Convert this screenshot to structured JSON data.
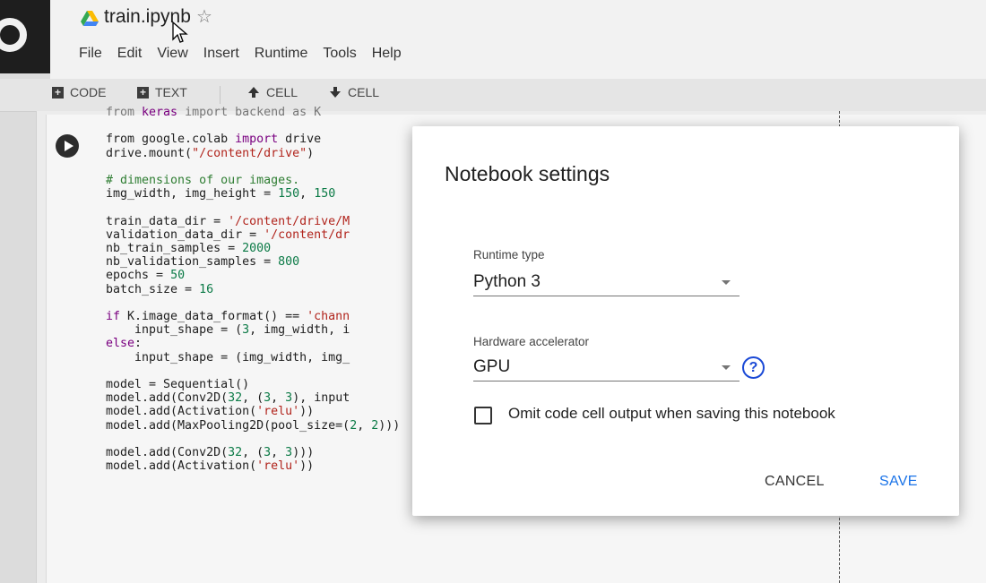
{
  "header": {
    "title": "train.ipynb",
    "star_icon": "☆",
    "menu": [
      {
        "label": "File"
      },
      {
        "label": "Edit"
      },
      {
        "label": "View"
      },
      {
        "label": "Insert"
      },
      {
        "label": "Runtime"
      },
      {
        "label": "Tools"
      },
      {
        "label": "Help"
      }
    ]
  },
  "toolbar": {
    "code_label": "CODE",
    "text_label": "TEXT",
    "cell_up_label": "CELL",
    "cell_down_label": "CELL"
  },
  "code_lines": [
    [
      [
        "t",
        "from "
      ],
      [
        "k",
        "keras"
      ],
      [
        "t",
        " import backend as K"
      ]
    ],
    [
      [
        "t",
        ""
      ]
    ],
    [
      [
        "t",
        "from google.colab "
      ],
      [
        "k",
        "import"
      ],
      [
        "t",
        " drive"
      ]
    ],
    [
      [
        "t",
        "drive.mount("
      ],
      [
        "s",
        "\"/content/drive\""
      ],
      [
        "t",
        ")"
      ]
    ],
    [
      [
        "t",
        ""
      ]
    ],
    [
      [
        "c",
        "# dimensions of our images."
      ]
    ],
    [
      [
        "t",
        "img_width, img_height = "
      ],
      [
        "n",
        "150"
      ],
      [
        "t",
        ", "
      ],
      [
        "n",
        "150"
      ]
    ],
    [
      [
        "t",
        ""
      ]
    ],
    [
      [
        "t",
        "train_data_dir = "
      ],
      [
        "s",
        "'/content/drive/M"
      ]
    ],
    [
      [
        "t",
        "validation_data_dir = "
      ],
      [
        "s",
        "'/content/dr"
      ]
    ],
    [
      [
        "t",
        "nb_train_samples = "
      ],
      [
        "n",
        "2000"
      ]
    ],
    [
      [
        "t",
        "nb_validation_samples = "
      ],
      [
        "n",
        "800"
      ]
    ],
    [
      [
        "t",
        "epochs = "
      ],
      [
        "n",
        "50"
      ]
    ],
    [
      [
        "t",
        "batch_size = "
      ],
      [
        "n",
        "16"
      ]
    ],
    [
      [
        "t",
        ""
      ]
    ],
    [
      [
        "k",
        "if"
      ],
      [
        "t",
        " K.image_data_format() == "
      ],
      [
        "s",
        "'chann"
      ]
    ],
    [
      [
        "t",
        "    input_shape = ("
      ],
      [
        "n",
        "3"
      ],
      [
        "t",
        ", img_width, i"
      ]
    ],
    [
      [
        "k",
        "else"
      ],
      [
        "t",
        ":"
      ]
    ],
    [
      [
        "t",
        "    input_shape = (img_width, img_"
      ]
    ],
    [
      [
        "t",
        ""
      ]
    ],
    [
      [
        "t",
        "model = Sequential()"
      ]
    ],
    [
      [
        "t",
        "model.add(Conv2D("
      ],
      [
        "n",
        "32"
      ],
      [
        "t",
        ", ("
      ],
      [
        "n",
        "3"
      ],
      [
        "t",
        ", "
      ],
      [
        "n",
        "3"
      ],
      [
        "t",
        "), input"
      ]
    ],
    [
      [
        "t",
        "model.add(Activation("
      ],
      [
        "s",
        "'relu'"
      ],
      [
        "t",
        "))"
      ]
    ],
    [
      [
        "t",
        "model.add(MaxPooling2D(pool_size=("
      ],
      [
        "n",
        "2"
      ],
      [
        "t",
        ", "
      ],
      [
        "n",
        "2"
      ],
      [
        "t",
        ")))"
      ]
    ],
    [
      [
        "t",
        ""
      ]
    ],
    [
      [
        "t",
        "model.add(Conv2D("
      ],
      [
        "n",
        "32"
      ],
      [
        "t",
        ", ("
      ],
      [
        "n",
        "3"
      ],
      [
        "t",
        ", "
      ],
      [
        "n",
        "3"
      ],
      [
        "t",
        ")))"
      ]
    ],
    [
      [
        "t",
        "model.add(Activation("
      ],
      [
        "s",
        "'relu'"
      ],
      [
        "t",
        "))"
      ]
    ]
  ],
  "dialog": {
    "title": "Notebook settings",
    "runtime_label": "Runtime type",
    "runtime_value": "Python 3",
    "hardware_label": "Hardware accelerator",
    "hardware_value": "GPU",
    "help_icon": "?",
    "omit_checked": false,
    "omit_label": "Omit code cell output when saving this notebook",
    "cancel_label": "CANCEL",
    "save_label": "SAVE"
  },
  "colors": {
    "accent": "#1a73e8",
    "help": "#1a49d6",
    "keyword": "#7a0080",
    "string": "#b1241c",
    "number": "#0b7a46"
  }
}
